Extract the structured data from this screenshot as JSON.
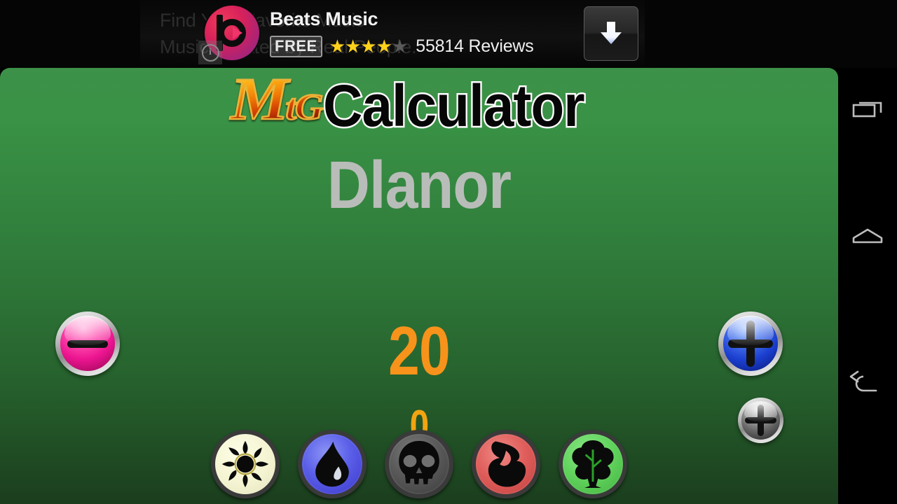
{
  "ad": {
    "app_name": "Beats Music",
    "price_badge": "FREE",
    "reviews": "55814 Reviews",
    "rating_filled": 4,
    "rating_total": 5,
    "background_line_1": "Find Your Favorite Music",
    "background_line_2": "Music Curated by Real People.",
    "logo_icon": "beats-logo-icon",
    "info_icon": "i",
    "download_icon": "download-arrow-icon"
  },
  "app": {
    "title_brand": "M",
    "title_brand_small": "tG",
    "title_word": "Calculator",
    "player_name": "Dlanor",
    "life_total": "20",
    "poison_total": "0",
    "accent_life_color": "#f7931b",
    "accent_poison_color": "#f2a411",
    "background_top_color": "#3d9149",
    "background_bottom_color": "#1b3e1e"
  },
  "controls": {
    "minus_label": "−",
    "plus_label": "+",
    "poison_plus_label": "+",
    "minus_color": "#ec1590",
    "plus_color": "#1b3fd0",
    "poison_plus_color": "#6b6b6b"
  },
  "mana": [
    {
      "key": "white",
      "name": "mana-white-sun",
      "color": "#f4f4d2"
    },
    {
      "key": "blue",
      "name": "mana-blue-drop",
      "color": "#5a5ee8"
    },
    {
      "key": "black",
      "name": "mana-black-skull",
      "color": "#5a5a5a"
    },
    {
      "key": "red",
      "name": "mana-red-fire",
      "color": "#e05f5c"
    },
    {
      "key": "green",
      "name": "mana-green-tree",
      "color": "#62d45e"
    }
  ],
  "navbar": {
    "recents_label": "recents-icon",
    "home_label": "home-icon",
    "back_label": "back-icon"
  }
}
